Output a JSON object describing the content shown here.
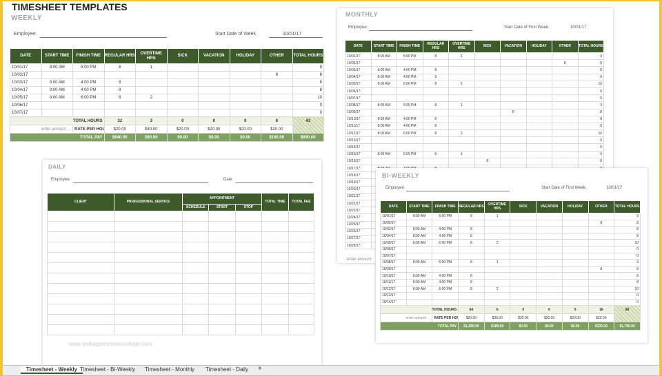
{
  "page_title": "TIMESHEET TEMPLATES",
  "watermark": "www.heritagechristiancollege.com",
  "weekly": {
    "subtitle": "WEEKLY",
    "employee_label": "Employee:",
    "start_label": "Start Date of Week",
    "start_value": "10/01/17",
    "headers": [
      "DATE",
      "START TIME",
      "FINISH TIME",
      "REGULAR HRS",
      "OVERTIME HRS",
      "SICK",
      "VACATION",
      "HOLIDAY",
      "OTHER",
      "TOTAL HOURS"
    ],
    "rows": [
      [
        "10/01/17",
        "8:00 AM",
        "5:00 PM",
        "8",
        "1",
        "",
        "",
        "",
        "",
        "9"
      ],
      [
        "10/02/17",
        "",
        "",
        "",
        "",
        "",
        "",
        "",
        "8",
        "8"
      ],
      [
        "10/03/17",
        "8:00 AM",
        "4:00 PM",
        "8",
        "",
        "",
        "",
        "",
        "",
        "8"
      ],
      [
        "10/04/17",
        "8:00 AM",
        "4:00 PM",
        "8",
        "",
        "",
        "",
        "",
        "",
        "8"
      ],
      [
        "10/05/17",
        "8:00 AM",
        "6:00 PM",
        "8",
        "2",
        "",
        "",
        "",
        "",
        "10"
      ],
      [
        "10/06/17",
        "",
        "",
        "",
        "",
        "",
        "",
        "",
        "",
        "0"
      ],
      [
        "10/07/17",
        "",
        "",
        "",
        "",
        "",
        "",
        "",
        "",
        "0"
      ]
    ],
    "totals_label": "TOTAL HOURS",
    "totals": [
      "32",
      "3",
      "0",
      "0",
      "0",
      "8",
      "43"
    ],
    "rate_hint": "enter amount →",
    "rate_label": "RATE PER HOUR",
    "rates": [
      "$20.00",
      "$30.00",
      "$20.00",
      "$20.00",
      "$20.00",
      "$20.00"
    ],
    "pay_label": "TOTAL PAY",
    "pays": [
      "$640.00",
      "$90.00",
      "$0.00",
      "$0.00",
      "$0.00",
      "$160.00",
      "$890.00"
    ]
  },
  "monthly": {
    "subtitle": "MONTHLY",
    "employee_label": "Employee:",
    "start_label": "Start Date of First Week:",
    "start_value": "10/01/17",
    "headers": [
      "DATE",
      "START TIME",
      "FINISH TIME",
      "REGULAR HRS",
      "OVERTIME HRS",
      "SICK",
      "VACATION",
      "HOLIDAY",
      "OTHER",
      "TOTAL HOURS"
    ],
    "rows": [
      [
        "10/01/17",
        "8:00 AM",
        "5:00 PM",
        "8",
        "1",
        "",
        "",
        "",
        "",
        "9"
      ],
      [
        "10/02/17",
        "",
        "",
        "",
        "",
        "",
        "",
        "",
        "8",
        "8"
      ],
      [
        "10/03/17",
        "8:00 AM",
        "4:00 PM",
        "8",
        "",
        "",
        "",
        "",
        "",
        "8"
      ],
      [
        "10/04/17",
        "8:00 AM",
        "4:00 PM",
        "8",
        "",
        "",
        "",
        "",
        "",
        "8"
      ],
      [
        "10/05/17",
        "8:00 AM",
        "6:00 PM",
        "8",
        "2",
        "",
        "",
        "",
        "",
        "10"
      ],
      [
        "10/06/17",
        "",
        "",
        "",
        "",
        "",
        "",
        "",
        "",
        "0"
      ],
      [
        "10/07/17",
        "",
        "",
        "",
        "",
        "",
        "",
        "",
        "",
        "0"
      ],
      [
        "10/08/17",
        "8:00 AM",
        "5:00 PM",
        "8",
        "1",
        "",
        "",
        "",
        "",
        "9"
      ],
      [
        "10/09/17",
        "",
        "",
        "",
        "",
        "",
        "8",
        "",
        "",
        "8"
      ],
      [
        "10/10/17",
        "8:00 AM",
        "4:00 PM",
        "8",
        "",
        "",
        "",
        "",
        "",
        "8"
      ],
      [
        "10/11/17",
        "8:00 AM",
        "4:00 PM",
        "8",
        "",
        "",
        "",
        "",
        "",
        "8"
      ],
      [
        "10/12/17",
        "8:00 AM",
        "6:00 PM",
        "8",
        "2",
        "",
        "",
        "",
        "",
        "10"
      ],
      [
        "10/13/17",
        "",
        "",
        "",
        "",
        "",
        "",
        "",
        "",
        "0"
      ],
      [
        "10/14/17",
        "",
        "",
        "",
        "",
        "",
        "",
        "",
        "",
        "0"
      ],
      [
        "10/15/17",
        "8:00 AM",
        "5:00 PM",
        "8",
        "1",
        "",
        "",
        "",
        "",
        "9"
      ],
      [
        "10/16/17",
        "",
        "",
        "",
        "",
        "8",
        "",
        "",
        "",
        "8"
      ],
      [
        "10/17/17",
        "8:00 AM",
        "4:00 PM",
        "8",
        "",
        "",
        "",
        "",
        "",
        "8"
      ],
      [
        "10/18/17",
        "8:00 AM",
        "4:00 PM",
        "8",
        "",
        "",
        "",
        "",
        "",
        "8"
      ],
      [
        "10/19/17",
        "",
        "",
        "",
        "",
        "",
        "",
        "",
        "",
        "0"
      ],
      [
        "10/20/17",
        "",
        "",
        "",
        "",
        "",
        "",
        "",
        "",
        "0"
      ],
      [
        "10/21/17",
        "",
        "",
        "",
        "",
        "",
        "",
        "",
        "",
        "0"
      ],
      [
        "10/22/17",
        "",
        "",
        "",
        "",
        "",
        "",
        "",
        "",
        "0"
      ],
      [
        "10/23/17",
        "",
        "",
        "",
        "",
        "",
        "",
        "",
        "",
        "0"
      ],
      [
        "10/24/17",
        "",
        "",
        "",
        "",
        "",
        "",
        "",
        "",
        "0"
      ],
      [
        "10/25/17",
        "",
        "",
        "",
        "",
        "",
        "",
        "",
        "",
        "0"
      ],
      [
        "10/26/17",
        "",
        "",
        "",
        "",
        "",
        "",
        "",
        "",
        "0"
      ],
      [
        "10/27/17",
        "",
        "",
        "",
        "",
        "",
        "",
        "",
        "",
        "0"
      ],
      [
        "10/28/17",
        "",
        "",
        "",
        "",
        "",
        "",
        "",
        "",
        "0"
      ]
    ],
    "rate_hint": "enter amount"
  },
  "daily": {
    "subtitle": "DAILY",
    "employee_label": "Employee:",
    "date_label": "Date",
    "headers": [
      "CLIENT",
      "PROFESSIONAL SERVICE",
      "APPOINTMENT",
      "TOTAL TIME",
      "TOTAL FEE"
    ],
    "sub_headers": [
      "SCHEDULE",
      "START",
      "STOP"
    ]
  },
  "biweekly": {
    "subtitle": "BI-WEEKLY",
    "employee_label": "Employee:",
    "start_label": "Start Date of First Week:",
    "start_value": "10/01/17",
    "headers": [
      "DATE",
      "START TIME",
      "FINISH TIME",
      "REGULAR HRS",
      "OVERTIME HRS",
      "SICK",
      "VACATION",
      "HOLIDAY",
      "OTHER",
      "TOTAL HOURS"
    ],
    "rows": [
      [
        "10/01/17",
        "8:00 AM",
        "5:00 PM",
        "8",
        "1",
        "",
        "",
        "",
        "",
        "9"
      ],
      [
        "10/02/17",
        "",
        "",
        "",
        "",
        "",
        "",
        "",
        "8",
        "8"
      ],
      [
        "10/03/17",
        "8:00 AM",
        "4:00 PM",
        "8",
        "",
        "",
        "",
        "",
        "",
        "8"
      ],
      [
        "10/04/17",
        "8:00 AM",
        "4:00 PM",
        "8",
        "",
        "",
        "",
        "",
        "",
        "8"
      ],
      [
        "10/05/17",
        "8:00 AM",
        "6:00 PM",
        "8",
        "2",
        "",
        "",
        "",
        "",
        "10"
      ],
      [
        "10/06/17",
        "",
        "",
        "",
        "",
        "",
        "",
        "",
        "",
        "0"
      ],
      [
        "10/07/17",
        "",
        "",
        "",
        "",
        "",
        "",
        "",
        "",
        "0"
      ],
      [
        "10/08/17",
        "8:00 AM",
        "5:00 PM",
        "8",
        "1",
        "",
        "",
        "",
        "",
        "9"
      ],
      [
        "10/09/17",
        "",
        "",
        "",
        "",
        "",
        "",
        "",
        "8",
        "8"
      ],
      [
        "10/10/17",
        "8:00 AM",
        "4:00 PM",
        "8",
        "",
        "",
        "",
        "",
        "",
        "8"
      ],
      [
        "10/11/17",
        "8:00 AM",
        "4:00 PM",
        "8",
        "",
        "",
        "",
        "",
        "",
        "8"
      ],
      [
        "10/12/17",
        "8:00 AM",
        "6:00 PM",
        "8",
        "2",
        "",
        "",
        "",
        "",
        "10"
      ],
      [
        "10/13/17",
        "",
        "",
        "",
        "",
        "",
        "",
        "",
        "",
        "0"
      ],
      [
        "10/14/17",
        "",
        "",
        "",
        "",
        "",
        "",
        "",
        "",
        "0"
      ]
    ],
    "totals_label": "TOTAL HOURS",
    "totals": [
      "64",
      "6",
      "0",
      "0",
      "0",
      "16",
      "86"
    ],
    "rate_hint": "enter amount →",
    "rate_label": "RATE PER HOUR",
    "rates": [
      "$20.00",
      "$30.00",
      "$20.00",
      "$20.00",
      "$20.00",
      "$20.00"
    ],
    "pay_label": "TOTAL PAY",
    "pays": [
      "$1,280.00",
      "$180.00",
      "$0.00",
      "$0.00",
      "$0.00",
      "$320.00",
      "$1,780.00"
    ]
  },
  "tabs": [
    "Timesheet - Weekly",
    "Timesheet - Bi-Weekly",
    "Timesheet - Monthly",
    "Timesheet - Daily"
  ],
  "add_tab_icon": "plus-icon",
  "colors": {
    "header_green": "#3c5a2a",
    "pay_green": "#7fa060",
    "frame_yellow": "#f4c430"
  }
}
